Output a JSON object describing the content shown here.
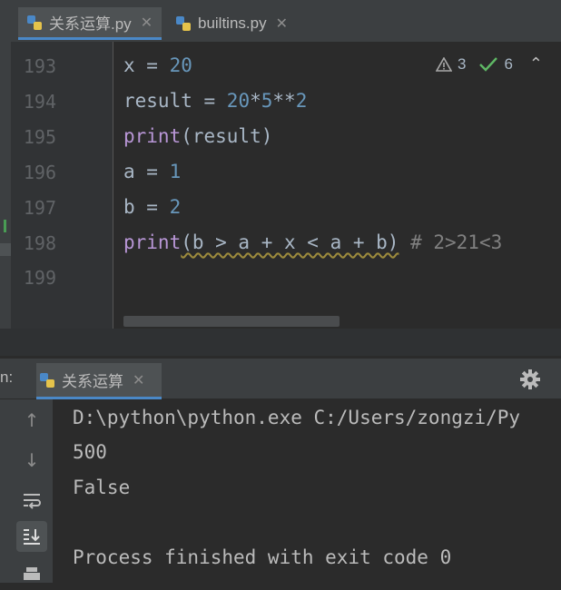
{
  "tabs": [
    {
      "label": "关系运算.py",
      "active": true
    },
    {
      "label": "builtins.py",
      "active": false
    }
  ],
  "editor": {
    "lines": [
      {
        "number": "193",
        "code": [
          "x = ",
          "20"
        ]
      },
      {
        "number": "194",
        "code": [
          "result = ",
          "20",
          "*",
          "5",
          "**",
          "2"
        ]
      },
      {
        "number": "195",
        "code": [
          "print",
          "(result)"
        ]
      },
      {
        "number": "196",
        "code": [
          "a = ",
          "1"
        ]
      },
      {
        "number": "197",
        "code": [
          "b = ",
          "2"
        ]
      },
      {
        "number": "198",
        "code": [
          "print",
          "(b > a + x < a + b)",
          " # 2>21<3"
        ]
      },
      {
        "number": "199",
        "code": []
      }
    ],
    "inspections": {
      "warnings": "3",
      "weak_warnings": "6"
    }
  },
  "run": {
    "label": "n:",
    "tab_label": "关系运算",
    "output": [
      "D:\\python\\python.exe C:/Users/zongzi/Py",
      "500",
      "False",
      "",
      "Process finished with exit code 0"
    ]
  },
  "colors": {
    "number": "#6897bb",
    "keyword": "#b896d6",
    "comment": "#808080",
    "accent": "#4a88c7"
  }
}
